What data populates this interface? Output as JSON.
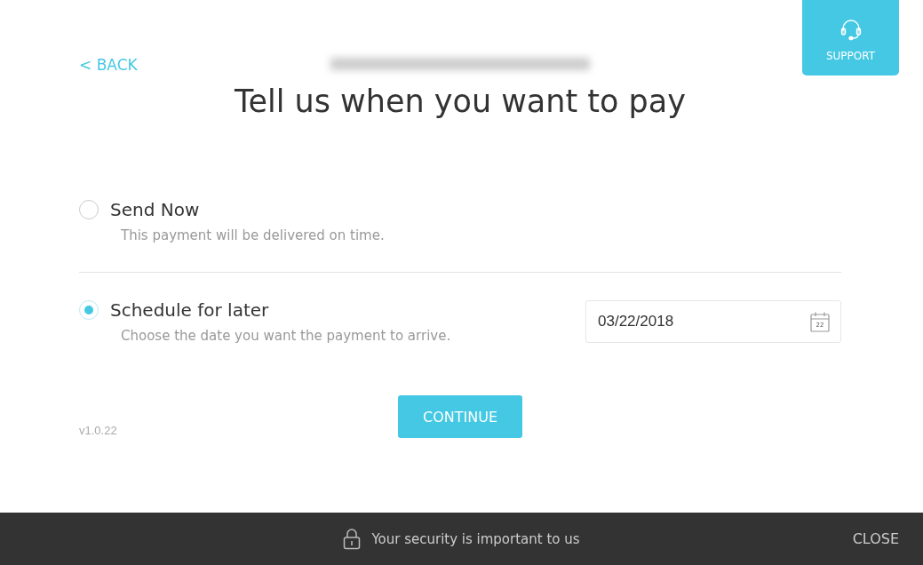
{
  "back_link": "< BACK",
  "support_button": {
    "label": "SUPPORT"
  },
  "title": "Tell us when you want to pay",
  "options": [
    {
      "title": "Send Now",
      "description": "This payment will be delivered on time.",
      "selected": false
    },
    {
      "title": "Schedule for later",
      "description": "Choose the date you want the payment to arrive.",
      "selected": true,
      "date": {
        "value": "03/22/2018",
        "calendar_day": "22"
      }
    }
  ],
  "continue_button": "CONTINUE",
  "version": "v1.0.22",
  "footer": {
    "message": "Your security is important to us",
    "close": "CLOSE"
  }
}
